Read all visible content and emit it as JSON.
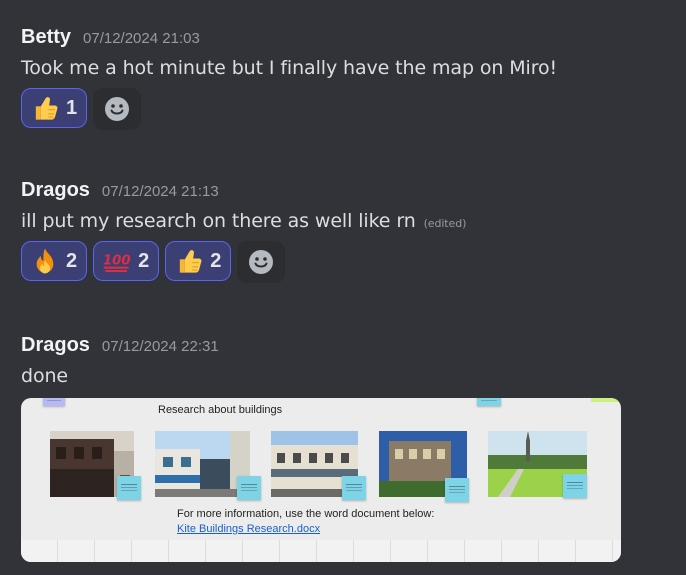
{
  "colors": {
    "background": "#313338",
    "reaction_bg": "#3b3f73",
    "reaction_border": "#5865f2",
    "add_reaction_bg": "#2b2d31",
    "author": "#f2f3f5",
    "timestamp": "#949ba4",
    "link": "#1a5fd0"
  },
  "messages": [
    {
      "author": "Betty",
      "timestamp": "07/12/2024 21:03",
      "text": "Took me a hot minute but I finally have the map on Miro!",
      "reactions": [
        {
          "emoji": "thumbs-up",
          "count": "1"
        }
      ]
    },
    {
      "author": "Dragos",
      "timestamp": "07/12/2024 21:13",
      "text": "ill put my research on there as well like rn",
      "edited": "(edited)",
      "reactions": [
        {
          "emoji": "fire",
          "count": "2"
        },
        {
          "emoji": "hundred-points",
          "count": "2"
        },
        {
          "emoji": "thumbs-up",
          "count": "2"
        }
      ]
    },
    {
      "author": "Dragos",
      "timestamp": "07/12/2024 22:31",
      "text": "done",
      "attachment": {
        "type": "image",
        "board_title": "Research about buildings",
        "note": "For more information, use the word document below:",
        "link_text": "Kite Buildings Research.docx"
      }
    }
  ]
}
